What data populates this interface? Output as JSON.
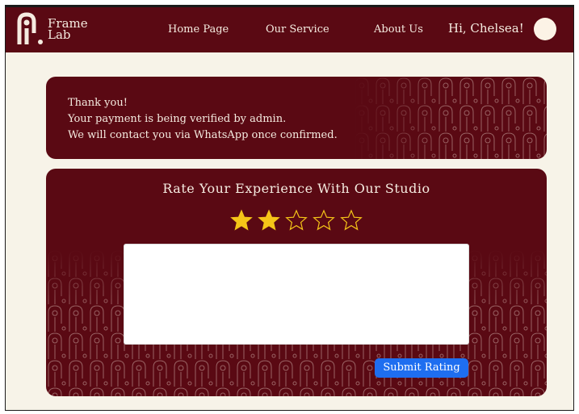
{
  "nav": {
    "logo_line1": "Frame",
    "logo_line2": "Lab",
    "links": [
      "Home Page",
      "Our Service",
      "About Us"
    ],
    "greeting": "Hi, Chelsea!"
  },
  "confirmation": {
    "line1": "Thank you!",
    "line2": "Your payment is being verified by admin.",
    "line3": "We will contact you via WhatsApp once confirmed."
  },
  "rating": {
    "title": "Rate Your Experience With Our Studio",
    "max_stars": 5,
    "selected": 2,
    "submit_label": "Submit Rating",
    "comment_value": ""
  },
  "colors": {
    "brand": "#5a0913",
    "background": "#f7f3e8",
    "star_fill": "#f5c518",
    "submit": "#1e6ef0"
  }
}
